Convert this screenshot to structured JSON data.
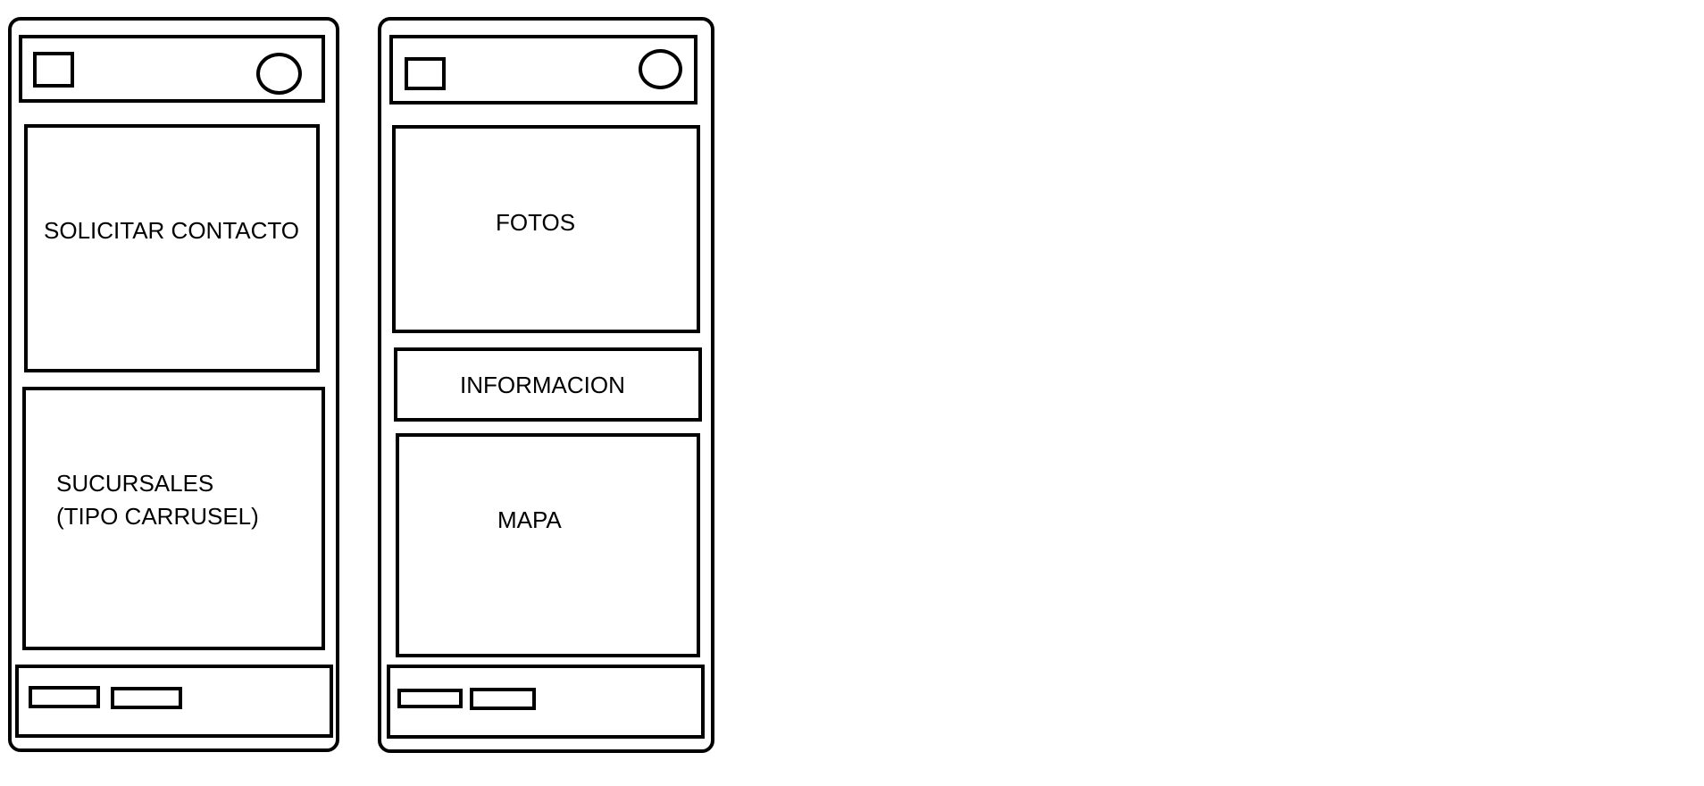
{
  "colors": {
    "stroke": "#000000",
    "background": "#ffffff"
  },
  "screen_left": {
    "header": {
      "menu_icon": "square-icon",
      "profile_icon": "circle-icon"
    },
    "contact_label": "SOLICITAR CONTACTO",
    "branches_label_line1": "SUCURSALES",
    "branches_label_line2": "(TIPO CARRUSEL)",
    "footer": {
      "button_count": 2
    }
  },
  "screen_right": {
    "header": {
      "menu_icon": "square-icon",
      "profile_icon": "circle-icon"
    },
    "photos_label": "FOTOS",
    "info_label": "INFORMACION",
    "map_label": "MAPA",
    "footer": {
      "button_count": 2
    }
  }
}
